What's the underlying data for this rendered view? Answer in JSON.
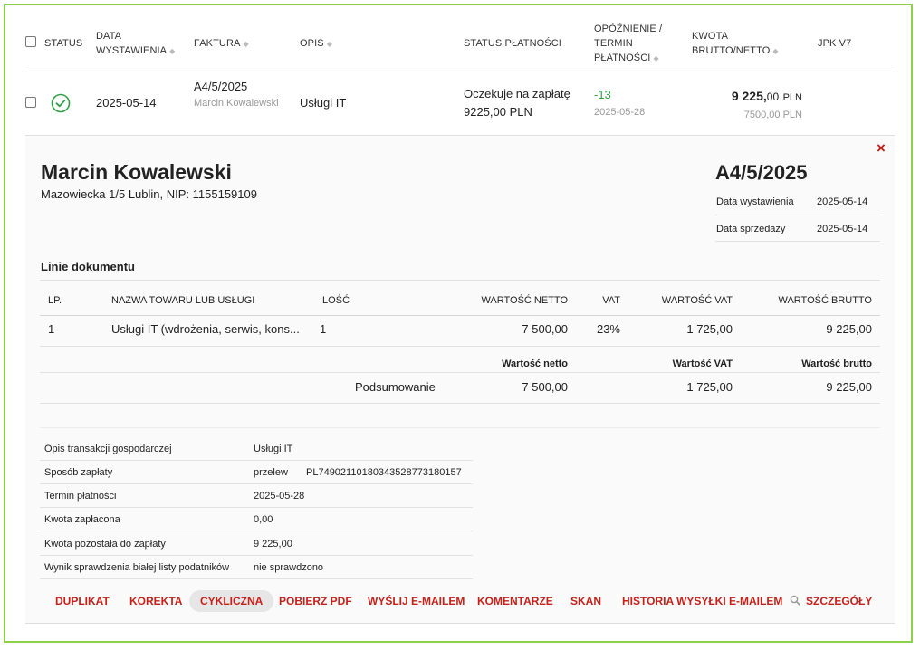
{
  "table": {
    "headers": {
      "status": "STATUS",
      "date_line1": "DATA",
      "date_line2": "WYSTAWIENIA",
      "invoice": "FAKTURA",
      "description": "OPIS",
      "payment_status": "STATUS PŁATNOŚCI",
      "delay_line1": "OPÓŹNIENIE /",
      "delay_line2": "TERMIN",
      "delay_line3": "PŁATNOŚCI",
      "amount_line1": "KWOTA",
      "amount_line2": "BRUTTO/NETTO",
      "jpk": "JPK V7"
    },
    "row": {
      "date": "2025-05-14",
      "invoice_no": "A4/5/2025",
      "client": "Marcin Kowalewski",
      "description": "Usługi IT",
      "payment_status": "Oczekuje na zapłatę",
      "payment_amount": "9225,00 PLN",
      "delay": "-13",
      "due_date": "2025-05-28",
      "gross_main": "9 225,",
      "gross_decimals": "00",
      "gross_currency": "PLN",
      "net": "7500,00 PLN"
    }
  },
  "detail": {
    "close_icon": "×",
    "client_name": "Marcin Kowalewski",
    "client_address": "Mazowiecka 1/5 Lublin, NIP: 1155159109",
    "invoice_no": "A4/5/2025",
    "meta": [
      {
        "label": "Data wystawienia",
        "value": "2025-05-14"
      },
      {
        "label": "Data sprzedaży",
        "value": "2025-05-14"
      }
    ],
    "lines_title": "Linie dokumentu",
    "line_headers": {
      "lp": "LP.",
      "name": "NAZWA TOWARU LUB USŁUGI",
      "qty": "ILOŚĆ",
      "net": "WARTOŚĆ NETTO",
      "vat": "VAT",
      "vat_value": "WARTOŚĆ VAT",
      "gross": "WARTOŚĆ BRUTTO"
    },
    "line": {
      "lp": "1",
      "name": "Usługi IT (wdrożenia, serwis, kons...",
      "qty": "1",
      "net": "7 500,00",
      "vat": "23%",
      "vat_value": "1 725,00",
      "gross": "9 225,00"
    },
    "summary": {
      "net_label": "Wartość netto",
      "vat_label": "Wartość VAT",
      "gross_label": "Wartość brutto",
      "label": "Podsumowanie",
      "net": "7 500,00",
      "vat": "1 725,00",
      "gross": "9 225,00"
    },
    "info": {
      "description_label": "Opis transakcji gospodarczej",
      "description_value": "Usługi IT",
      "payment_method_label": "Sposób zapłaty",
      "payment_method_value": "przelew",
      "account_no": "PL74902110180343528773180157",
      "due_label": "Termin płatności",
      "due_value": "2025-05-28",
      "paid_label": "Kwota zapłacona",
      "paid_value": "0,00",
      "remaining_label": "Kwota pozostała do zapłaty",
      "remaining_value": "9 225,00",
      "whitelist_label": "Wynik sprawdzenia białej listy podatników",
      "whitelist_value": "nie sprawdzono"
    },
    "actions": {
      "duplicate": "DUPLIKAT",
      "correction": "KOREKTA",
      "cyclic": "CYKLICZNA",
      "pdf": "POBIERZ PDF",
      "email": "WYŚLIJ E-MAILEM",
      "comments": "KOMENTARZE",
      "scan": "SKAN",
      "email_history": "HISTORIA WYSYŁKI E-MAILEM",
      "details": "SZCZEGÓŁY"
    }
  },
  "colors": {
    "border": "#8bd14a",
    "status_ok": "#2f9e44",
    "delay": "#2f9e44",
    "action": "#c4211a"
  }
}
